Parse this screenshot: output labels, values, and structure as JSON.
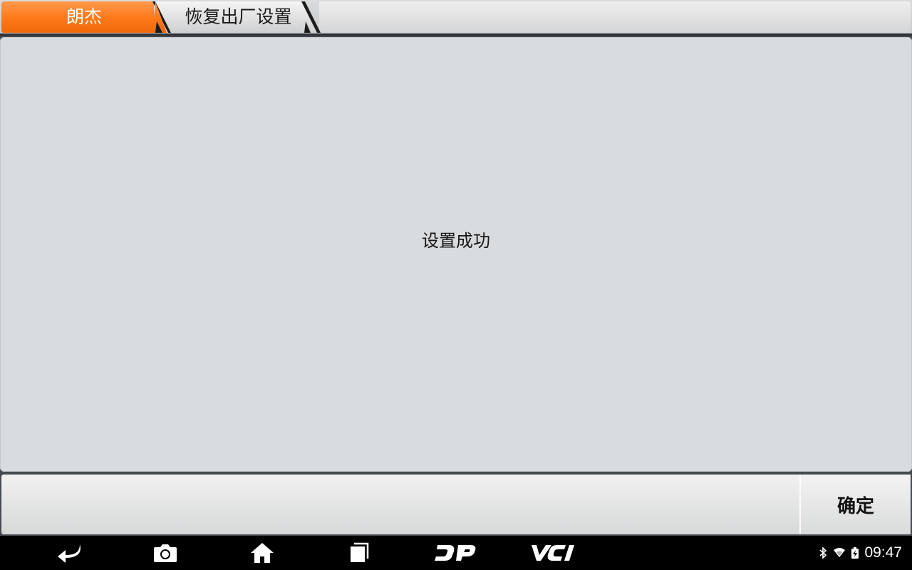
{
  "breadcrumb": {
    "items": [
      {
        "label": "朗杰"
      },
      {
        "label": "恢复出厂设置"
      }
    ]
  },
  "main": {
    "message": "设置成功"
  },
  "actions": {
    "confirm_label": "确定"
  },
  "navbar": {
    "buttons": [
      {
        "icon": "back-icon"
      },
      {
        "icon": "camera-icon"
      },
      {
        "icon": "home-icon"
      },
      {
        "icon": "recent-apps-icon"
      },
      {
        "icon": "dp-logo-icon"
      },
      {
        "icon": "vci-logo-icon"
      }
    ]
  },
  "status": {
    "time": "09:47",
    "icons": [
      "bluetooth-icon",
      "wifi-icon",
      "battery-icon"
    ]
  },
  "colors": {
    "accent": "#ff7a1c",
    "panel": "#d8dcdf",
    "navbar": "#000000"
  }
}
